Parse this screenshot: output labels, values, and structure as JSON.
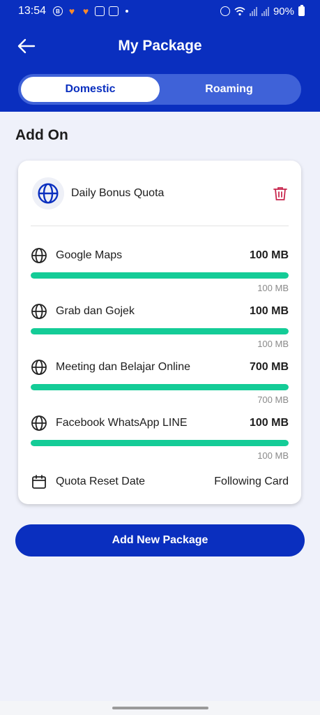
{
  "status": {
    "time": "13:54",
    "battery": "90%"
  },
  "header": {
    "title": "My Package"
  },
  "tabs": [
    {
      "label": "Domestic",
      "active": true
    },
    {
      "label": "Roaming",
      "active": false
    }
  ],
  "section_title": "Add On",
  "card": {
    "title": "Daily Bonus Quota",
    "items": [
      {
        "label": "Google Maps",
        "value": "100 MB",
        "total": "100 MB",
        "fill": 1.0
      },
      {
        "label": "Grab dan Gojek",
        "value": "100 MB",
        "total": "100 MB",
        "fill": 1.0
      },
      {
        "label": "Meeting dan Belajar Online",
        "value": "700 MB",
        "total": "700 MB",
        "fill": 1.0
      },
      {
        "label": "Facebook WhatsApp LINE",
        "value": "100 MB",
        "total": "100 MB",
        "fill": 1.0
      }
    ],
    "reset": {
      "label": "Quota Reset Date",
      "value": "Following Card"
    }
  },
  "add_button": "Add New Package",
  "colors": {
    "brand": "#0a2fbf",
    "progress": "#14cc97",
    "delete": "#c8284e"
  }
}
